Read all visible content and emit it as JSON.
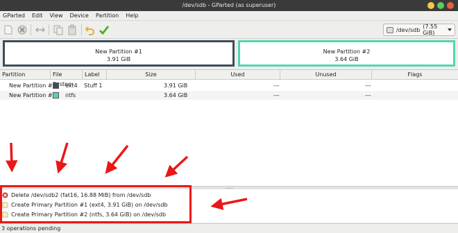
{
  "window": {
    "title": "/dev/sdb - GParted (as superuser)"
  },
  "menu": {
    "items": [
      "GParted",
      "Edit",
      "View",
      "Device",
      "Partition",
      "Help"
    ]
  },
  "toolbar": {
    "icons": [
      "new-icon",
      "delete-icon",
      "resize-move-icon",
      "copy-icon",
      "paste-icon",
      "undo-icon",
      "apply-icon"
    ],
    "device_name": "/dev/sdb",
    "device_size": "(7.55 GiB)"
  },
  "graphic": {
    "partitions": [
      {
        "name": "New Partition #1",
        "size": "3.91 GiB",
        "color": "#3d4c5c"
      },
      {
        "name": "New Partition #2",
        "size": "3.64 GiB",
        "color": "#52d6b0"
      }
    ]
  },
  "table": {
    "headers": [
      "Partition",
      "File System",
      "Label",
      "Size",
      "Used",
      "Unused",
      "Flags"
    ],
    "rows": [
      {
        "partition": "New Partition #1",
        "fs": "ext4",
        "fs_color": "#3d4c5c",
        "label": "Stuff 1",
        "size": "3.91 GiB",
        "used": "---",
        "unused": "---",
        "flags": ""
      },
      {
        "partition": "New Partition #2",
        "fs": "ntfs",
        "fs_color": "#52d6b0",
        "label": "",
        "size": "3.64 GiB",
        "used": "---",
        "unused": "---",
        "flags": ""
      }
    ]
  },
  "splitter": {
    "grip": "......"
  },
  "operations": [
    {
      "icon": "delete-icon",
      "text": "Delete /dev/sdb2 (fat16, 16.88 MiB) from /dev/sdb"
    },
    {
      "icon": "new-partition-icon",
      "text": "Create Primary Partition #1 (ext4, 3.91 GiB) on /dev/sdb"
    },
    {
      "icon": "new-partition-icon",
      "text": "Create Primary Partition #2 (ntfs, 3.64 GiB) on /dev/sdb"
    }
  ],
  "status": {
    "text": "3 operations pending"
  },
  "annotation": {
    "box_color": "#ea1717"
  }
}
